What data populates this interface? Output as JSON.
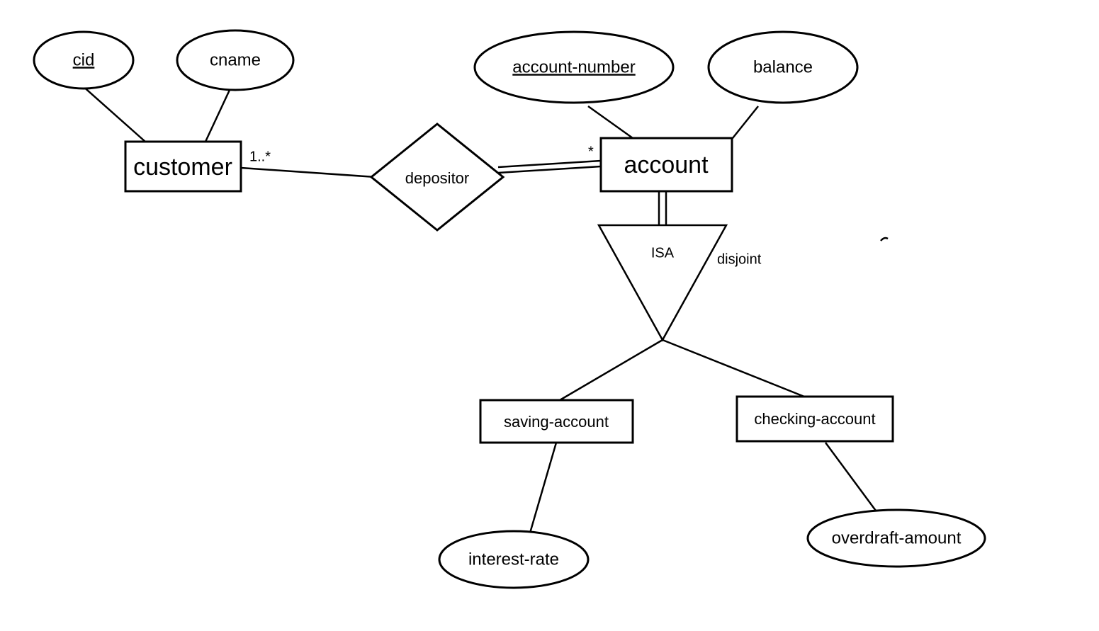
{
  "entities": {
    "customer": {
      "label": "customer"
    },
    "account": {
      "label": "account"
    },
    "saving_account": {
      "label": "saving-account"
    },
    "checking_account": {
      "label": "checking-account"
    }
  },
  "attributes": {
    "cid": {
      "label": "cid",
      "key": true
    },
    "cname": {
      "label": "cname",
      "key": false
    },
    "account_number": {
      "label": "account-number",
      "key": true
    },
    "balance": {
      "label": "balance",
      "key": false
    },
    "interest_rate": {
      "label": "interest-rate",
      "key": false
    },
    "overdraft_amount": {
      "label": "overdraft-amount",
      "key": false
    }
  },
  "relationships": {
    "depositor": {
      "label": "depositor"
    }
  },
  "cardinalities": {
    "customer_depositor": "1..*",
    "account_depositor": "*"
  },
  "specialization": {
    "isa": "ISA",
    "constraint": "disjoint"
  }
}
